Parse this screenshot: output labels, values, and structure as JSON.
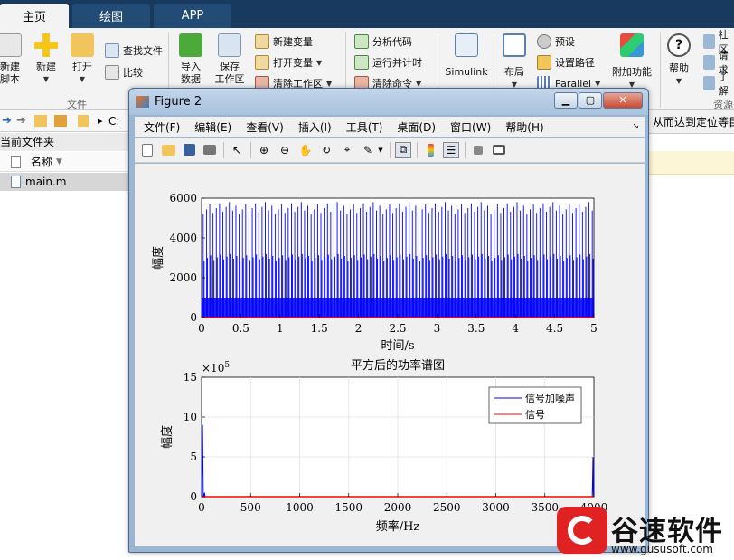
{
  "tabs": [
    {
      "label": "主页",
      "active": true
    },
    {
      "label": "绘图",
      "active": false
    },
    {
      "label": "APP",
      "active": false
    }
  ],
  "ribbon": {
    "new_script": "新建\n脚本",
    "new": "新建",
    "open": "打开",
    "find_files": "查找文件",
    "compare": "比较",
    "file_group": "文件",
    "import": "导入\n数据",
    "save_ws": "保存\n工作区",
    "new_var": "新建变量",
    "open_var": "打开变量",
    "clear_ws": "清除工作区",
    "analyze_code": "分析代码",
    "run_time": "运行并计时",
    "clear_cmd": "清除命令",
    "simulink": "Simulink",
    "layout": "布局",
    "prefs": "预设",
    "set_path": "设置路径",
    "parallel": "Parallel",
    "addons": "附加功能",
    "help": "帮助",
    "community": "社区",
    "request": "请求",
    "learn": "了解",
    "resources_group": "资源"
  },
  "left": {
    "path_fragment": "C:",
    "current_folder": "当前文件夹",
    "name_col": "名称",
    "file": "main.m"
  },
  "right_fragment": "从而达到定位等目",
  "figure": {
    "title": "Figure 2",
    "menus": [
      "文件(F)",
      "编辑(E)",
      "查看(V)",
      "插入(I)",
      "工具(T)",
      "桌面(D)",
      "窗口(W)",
      "帮助(H)"
    ]
  },
  "colors": {
    "blue_series": "#0000ff",
    "red_series": "#ff0000",
    "tab_bar": "#173a5e"
  },
  "chart_data": [
    {
      "type": "line",
      "title": "",
      "xlabel": "时间/s",
      "ylabel": "幅度",
      "xlim": [
        0,
        5
      ],
      "ylim": [
        0,
        6000
      ],
      "xticks": [
        0,
        0.5,
        1,
        1.5,
        2,
        2.5,
        3,
        3.5,
        4,
        4.5,
        5
      ],
      "yticks": [
        0,
        2000,
        4000,
        6000
      ],
      "grid": false,
      "series": [
        {
          "name": "",
          "color": "#0000ff",
          "description": "dense spikes",
          "peak_range": [
            5200,
            5800
          ],
          "spike_count": 120
        },
        {
          "name": "",
          "color": "#ff0000",
          "y": 0
        }
      ]
    },
    {
      "type": "line",
      "title": "平方后的功率谱图",
      "xlabel": "频率/Hz",
      "ylabel": "幅度",
      "y_exponent": "×10^5",
      "xlim": [
        0,
        4000
      ],
      "ylim": [
        0,
        15
      ],
      "xticks": [
        0,
        500,
        1000,
        1500,
        2000,
        2500,
        3000,
        3500,
        4000
      ],
      "yticks": [
        0,
        5,
        10,
        15
      ],
      "grid": true,
      "legend_position": "top-right",
      "series": [
        {
          "name": "信号加噪声",
          "color": "#0000ff",
          "peaks": [
            {
              "x": 10,
              "y": 9
            },
            {
              "x": 30,
              "y": 0.5
            },
            {
              "x": 3990,
              "y": 2.3
            },
            {
              "x": 4010,
              "y": 5
            },
            {
              "x": 4030,
              "y": 2.3
            }
          ]
        },
        {
          "name": "信号",
          "color": "#ff0000",
          "y": 0
        }
      ]
    }
  ],
  "watermark": {
    "text": "谷速软件",
    "url": "www.gususoft.com"
  }
}
